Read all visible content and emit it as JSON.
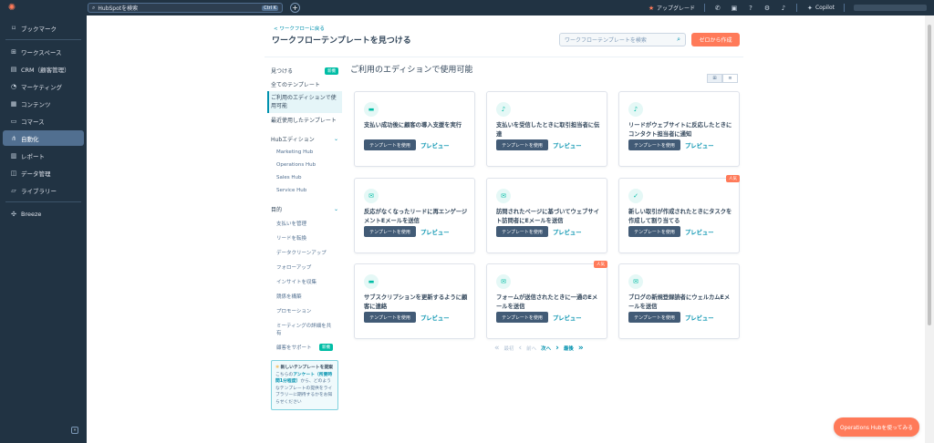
{
  "topbar": {
    "search_placeholder": "HubSpotを検索",
    "search_shortcut": "Ctrl K",
    "upgrade_label": "アップグレード",
    "copilot_label": "Copilot"
  },
  "sidebar": {
    "items": [
      {
        "label": "ブックマーク",
        "icon": "bookmark-icon"
      },
      {
        "label": "ワークスペース",
        "icon": "grid-icon"
      },
      {
        "label": "CRM（顧客管理）",
        "icon": "contacts-icon"
      },
      {
        "label": "マーケティング",
        "icon": "megaphone-icon"
      },
      {
        "label": "コンテンツ",
        "icon": "content-icon"
      },
      {
        "label": "コマース",
        "icon": "cart-icon"
      },
      {
        "label": "自動化",
        "icon": "automation-icon"
      },
      {
        "label": "レポート",
        "icon": "chart-icon"
      },
      {
        "label": "データ管理",
        "icon": "database-icon"
      },
      {
        "label": "ライブラリー",
        "icon": "folder-icon"
      },
      {
        "label": "Breeze",
        "icon": "breeze-icon"
      }
    ]
  },
  "header": {
    "back_link": "< ワークフローに戻る",
    "title": "ワークフローテンプレートを見つける",
    "search_placeholder": "ワークフローテンプレートを検索",
    "create_button": "ゼロから作成"
  },
  "filter": {
    "discover": "見つける",
    "new_badge": "新機",
    "all_templates": "全てのテンプレート",
    "available": "ご利用のエディションで使用可能",
    "recent": "最近使用したテンプレート",
    "hub_section": "Hubエディション",
    "hubs": [
      "Marketing Hub",
      "Operations Hub",
      "Sales Hub",
      "Service Hub"
    ],
    "goal_section": "目的",
    "goals": [
      "支払いを管理",
      "リードを転換",
      "データクリーンアップ",
      "フォローアップ",
      "インサイトを収集",
      "競係を構築",
      "プロモーション",
      "ミーティングの詳細を共有",
      "顧客をサポート"
    ],
    "support_badge": "新機",
    "feedback_title": "新しいテンプレートを提案",
    "feedback_pre": "こちらの",
    "feedback_link": "アンケート（所要時間1分程度）",
    "feedback_post": "から、どのようなテンプレートの提供をライブラリーに期待するかをお知らせください"
  },
  "content": {
    "title": "ご利用のエディションで使用可能",
    "view_grid": "⊞",
    "view_list": "≡",
    "use_label": "テンプレートを使用",
    "preview_label": "プレビュー",
    "popular_label": "人気",
    "cards": [
      {
        "title": "支払い成功後に顧客の導入支援を実行",
        "icon": "calendar-icon",
        "icon_glyph": "▬",
        "popular": false
      },
      {
        "title": "支払いを受信したときに取引担当者に伝達",
        "icon": "bell-icon",
        "icon_glyph": "♪",
        "popular": false
      },
      {
        "title": "リードがウェブサイトに反応したときにコンタクト担当者に通知",
        "icon": "bell-icon",
        "icon_glyph": "♪",
        "popular": false
      },
      {
        "title": "反応がなくなったリードに再エンゲージメントEメールを送信",
        "icon": "email-icon",
        "icon_glyph": "✉",
        "popular": false
      },
      {
        "title": "訪問されたページに基づいてウェブサイト訪問者にEメールを送信",
        "icon": "email-icon",
        "icon_glyph": "✉",
        "popular": false
      },
      {
        "title": "新しい取引が作成されたときにタスクを作成して割り当てる",
        "icon": "task-icon",
        "icon_glyph": "✓",
        "popular": true
      },
      {
        "title": "サブスクリプションを更新するように顧客に連絡",
        "icon": "calendar-icon",
        "icon_glyph": "▬",
        "popular": false
      },
      {
        "title": "フォームが送信されたときに一通のEメールを送信",
        "icon": "email-icon",
        "icon_glyph": "✉",
        "popular": true
      },
      {
        "title": "ブログの新規登録読者にウェルカムEメールを送信",
        "icon": "email-icon",
        "icon_glyph": "✉",
        "popular": false
      }
    ]
  },
  "pager": {
    "first": "最初",
    "prev": "前へ",
    "next": "次へ",
    "last": "最後"
  },
  "ops_button": "Operations Hubを使ってみる"
}
